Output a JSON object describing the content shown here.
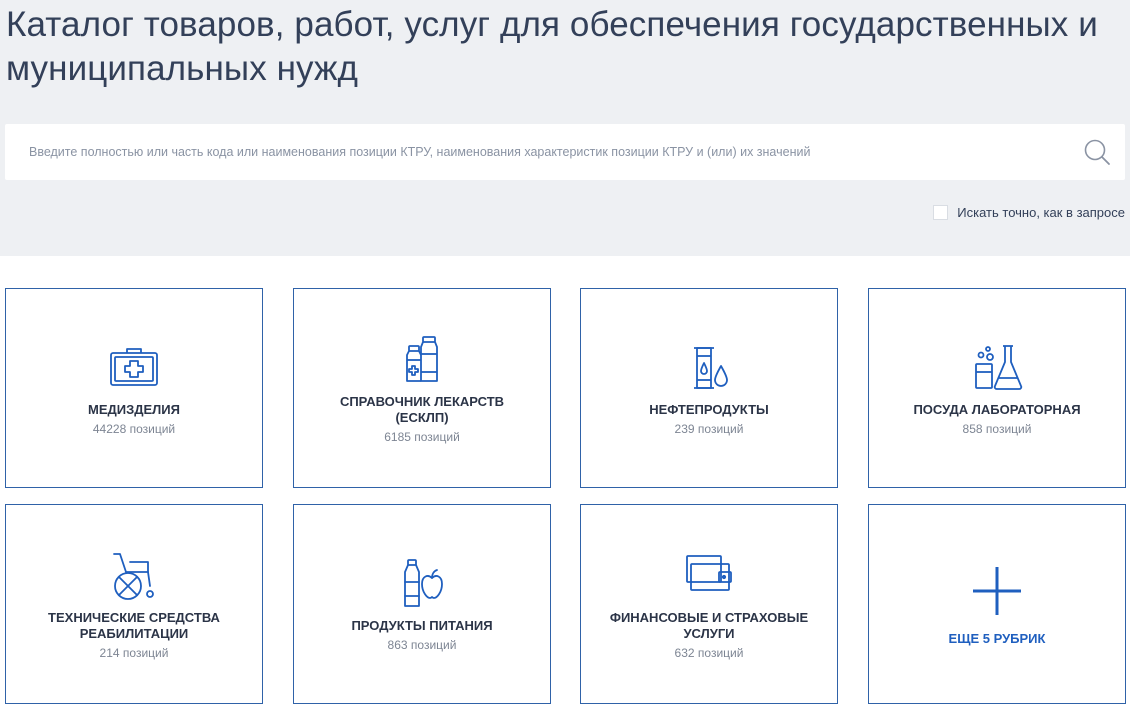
{
  "page": {
    "title": "Каталог товаров, работ, услуг для обеспечения государственных и муниципальных нужд"
  },
  "search": {
    "placeholder": "Введите полностью или часть кода или наименования позиции КТРУ, наименования характеристик позиции КТРУ и (или) их значений",
    "value": "",
    "exact_label": "Искать точно, как в запросе",
    "exact_checked": false
  },
  "categories": [
    {
      "name": "МЕДИЗДЕЛИЯ",
      "count": "44228 позиций",
      "icon": "medical-kit-icon"
    },
    {
      "name": "СПРАВОЧНИК ЛЕКАРСТВ (ЕСКЛП)",
      "count": "6185 позиций",
      "icon": "medicine-bottles-icon"
    },
    {
      "name": "НЕФТЕПРОДУКТЫ",
      "count": "239 позиций",
      "icon": "oil-barrel-icon"
    },
    {
      "name": "ПОСУДА ЛАБОРАТОРНАЯ",
      "count": "858 позиций",
      "icon": "lab-flask-icon"
    },
    {
      "name": "ТЕХНИЧЕСКИЕ СРЕДСТВА РЕАБИЛИТАЦИИ",
      "count": "214 позиций",
      "icon": "wheelchair-icon"
    },
    {
      "name": "ПРОДУКТЫ ПИТАНИЯ",
      "count": "863 позиций",
      "icon": "food-bottle-apple-icon"
    },
    {
      "name": "ФИНАНСОВЫЕ И СТРАХОВЫЕ УСЛУГИ",
      "count": "632 позиций",
      "icon": "wallet-icon"
    }
  ],
  "more": {
    "label": "ЕЩЕ 5 РУБРИК",
    "icon": "plus-icon"
  },
  "colors": {
    "accent": "#1f5fbf",
    "card_border": "#2f62a8",
    "header_bg": "#eef0f3",
    "title_text": "#334059"
  }
}
